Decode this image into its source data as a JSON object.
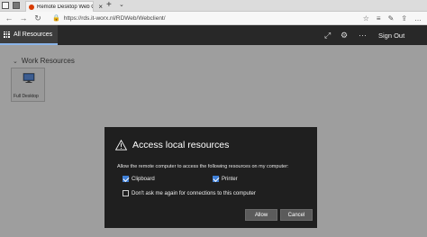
{
  "browser": {
    "tab_title": "Remote Desktop Web C",
    "tab_close": "×",
    "new_tab": "+",
    "tab_list": "⌄",
    "back": "←",
    "forward": "→",
    "refresh": "↻",
    "url": "https://rds.it-worx.nl/RDWeb/Webclient/",
    "right_icons": [
      "☆",
      "≡",
      "✎",
      "⇪",
      "…"
    ]
  },
  "header": {
    "all_resources_label": "All Resources",
    "sign_out_label": "Sign Out",
    "expand_icon": "⤢",
    "gear_icon": "⚙",
    "more_icon": "···"
  },
  "main": {
    "section_title": "Work Resources",
    "resources": [
      {
        "label": "Full Desktop"
      }
    ]
  },
  "dialog": {
    "title": "Access local resources",
    "message": "Allow the remote computer to access the following resources on my computer:",
    "options": [
      {
        "label": "Clipboard",
        "checked": true
      },
      {
        "label": "Printer",
        "checked": true
      },
      {
        "label": "Don't ask me again for connections to this computer",
        "checked": false
      }
    ],
    "allow_label": "Allow",
    "cancel_label": "Cancel"
  },
  "colors": {
    "header_bg": "#282828",
    "dialog_bg": "#1f1f1f",
    "checkbox_accent": "#3f7fd6",
    "tab_underline": "#8ab4e8"
  }
}
